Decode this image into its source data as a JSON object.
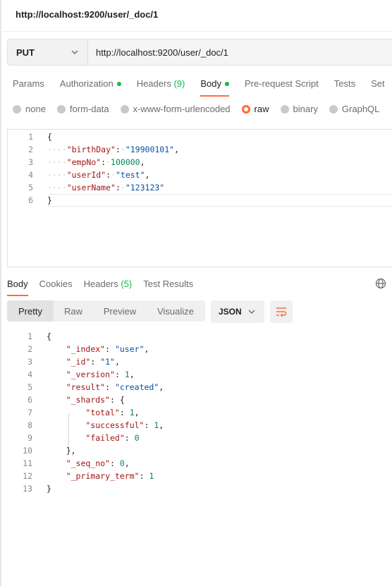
{
  "page_title": "http://localhost:9200/user/_doc/1",
  "request": {
    "method": "PUT",
    "url": "http://localhost:9200/user/_doc/1"
  },
  "tabs": {
    "params": "Params",
    "authorization": "Authorization",
    "headers": "Headers",
    "headers_count": "(9)",
    "body": "Body",
    "prerequest": "Pre-request Script",
    "tests": "Tests",
    "settings": "Set"
  },
  "body_modes": {
    "none": "none",
    "form_data": "form-data",
    "urlencoded": "x-www-form-urlencoded",
    "raw": "raw",
    "binary": "binary",
    "graphql": "GraphQL"
  },
  "request_body": [
    {
      "num": "1",
      "open": "{"
    },
    {
      "num": "2",
      "key": "\"birthDay\"",
      "value": "\"19900101\"",
      "value_type": "string",
      "comma": true
    },
    {
      "num": "3",
      "key": "\"empNo\"",
      "value": "100000",
      "value_type": "number",
      "comma": true
    },
    {
      "num": "4",
      "key": "\"userId\"",
      "value": "\"test\"",
      "value_type": "string",
      "comma": true
    },
    {
      "num": "5",
      "key": "\"userName\"",
      "value": "\"123123\"",
      "value_type": "string",
      "comma": false
    },
    {
      "num": "6",
      "close": "}"
    }
  ],
  "response_tabs": {
    "body": "Body",
    "cookies": "Cookies",
    "headers": "Headers",
    "headers_count": "(5)",
    "test_results": "Test Results"
  },
  "view_modes": {
    "pretty": "Pretty",
    "raw": "Raw",
    "preview": "Preview",
    "visualize": "Visualize"
  },
  "format": "JSON",
  "response_body": [
    {
      "num": "1",
      "text": "{"
    },
    {
      "num": "2",
      "key": "\"_index\"",
      "value": "\"user\"",
      "value_type": "string",
      "comma": true
    },
    {
      "num": "3",
      "key": "\"_id\"",
      "value": "\"1\"",
      "value_type": "string",
      "comma": true
    },
    {
      "num": "4",
      "key": "\"_version\"",
      "value": "1",
      "value_type": "number",
      "comma": true
    },
    {
      "num": "5",
      "key": "\"result\"",
      "value": "\"created\"",
      "value_type": "string",
      "comma": true
    },
    {
      "num": "6",
      "key": "\"_shards\"",
      "value": "{",
      "value_type": "punct",
      "comma": false
    },
    {
      "num": "7",
      "key": "\"total\"",
      "value": "1",
      "value_type": "number",
      "comma": true,
      "nested": true
    },
    {
      "num": "8",
      "key": "\"successful\"",
      "value": "1",
      "value_type": "number",
      "comma": true,
      "nested": true
    },
    {
      "num": "9",
      "key": "\"failed\"",
      "value": "0",
      "value_type": "number",
      "comma": false,
      "nested": true
    },
    {
      "num": "10",
      "text": "},",
      "indent_one": true
    },
    {
      "num": "11",
      "key": "\"_seq_no\"",
      "value": "0",
      "value_type": "number",
      "comma": true
    },
    {
      "num": "12",
      "key": "\"_primary_term\"",
      "value": "1",
      "value_type": "number",
      "comma": false
    },
    {
      "num": "13",
      "text": "}"
    }
  ],
  "colors": {
    "accent": "#ff6c37",
    "success": "#0cbb52",
    "json_key": "#a31515",
    "json_string": "#0451a5",
    "json_number": "#098658"
  },
  "icons": {
    "method_dropdown": "chevron-down-icon",
    "format_dropdown": "chevron-down-icon",
    "wrap": "wrap-lines-icon",
    "globe": "globe-icon"
  }
}
